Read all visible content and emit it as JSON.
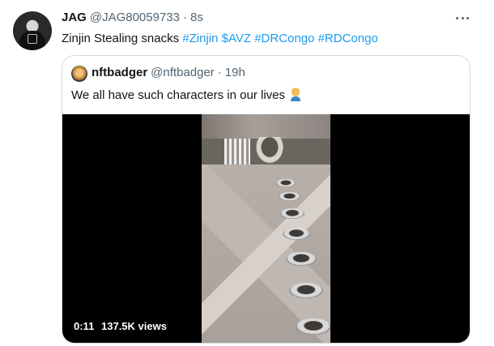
{
  "tweet": {
    "name": "JAG",
    "handle": "@JAG80059733",
    "separator": "·",
    "time": "8s",
    "text_plain": "Zinjin Stealing snacks ",
    "hashtags": [
      "#Zinjin",
      "$AVZ",
      "#DRCongo",
      "#RDCongo"
    ]
  },
  "quoted": {
    "name": "nftbadger",
    "handle": "@nftbadger",
    "separator": "·",
    "time": "19h",
    "text": "We all have such characters in our lives",
    "emoji": "person-facepalming-emoji"
  },
  "video": {
    "duration": "0:11",
    "views": "137.5K views"
  },
  "icons": {
    "more": "more-options-icon"
  },
  "colors": {
    "link": "#1d9bf0",
    "secondary_text": "#536471",
    "border": "#cfd9de"
  }
}
